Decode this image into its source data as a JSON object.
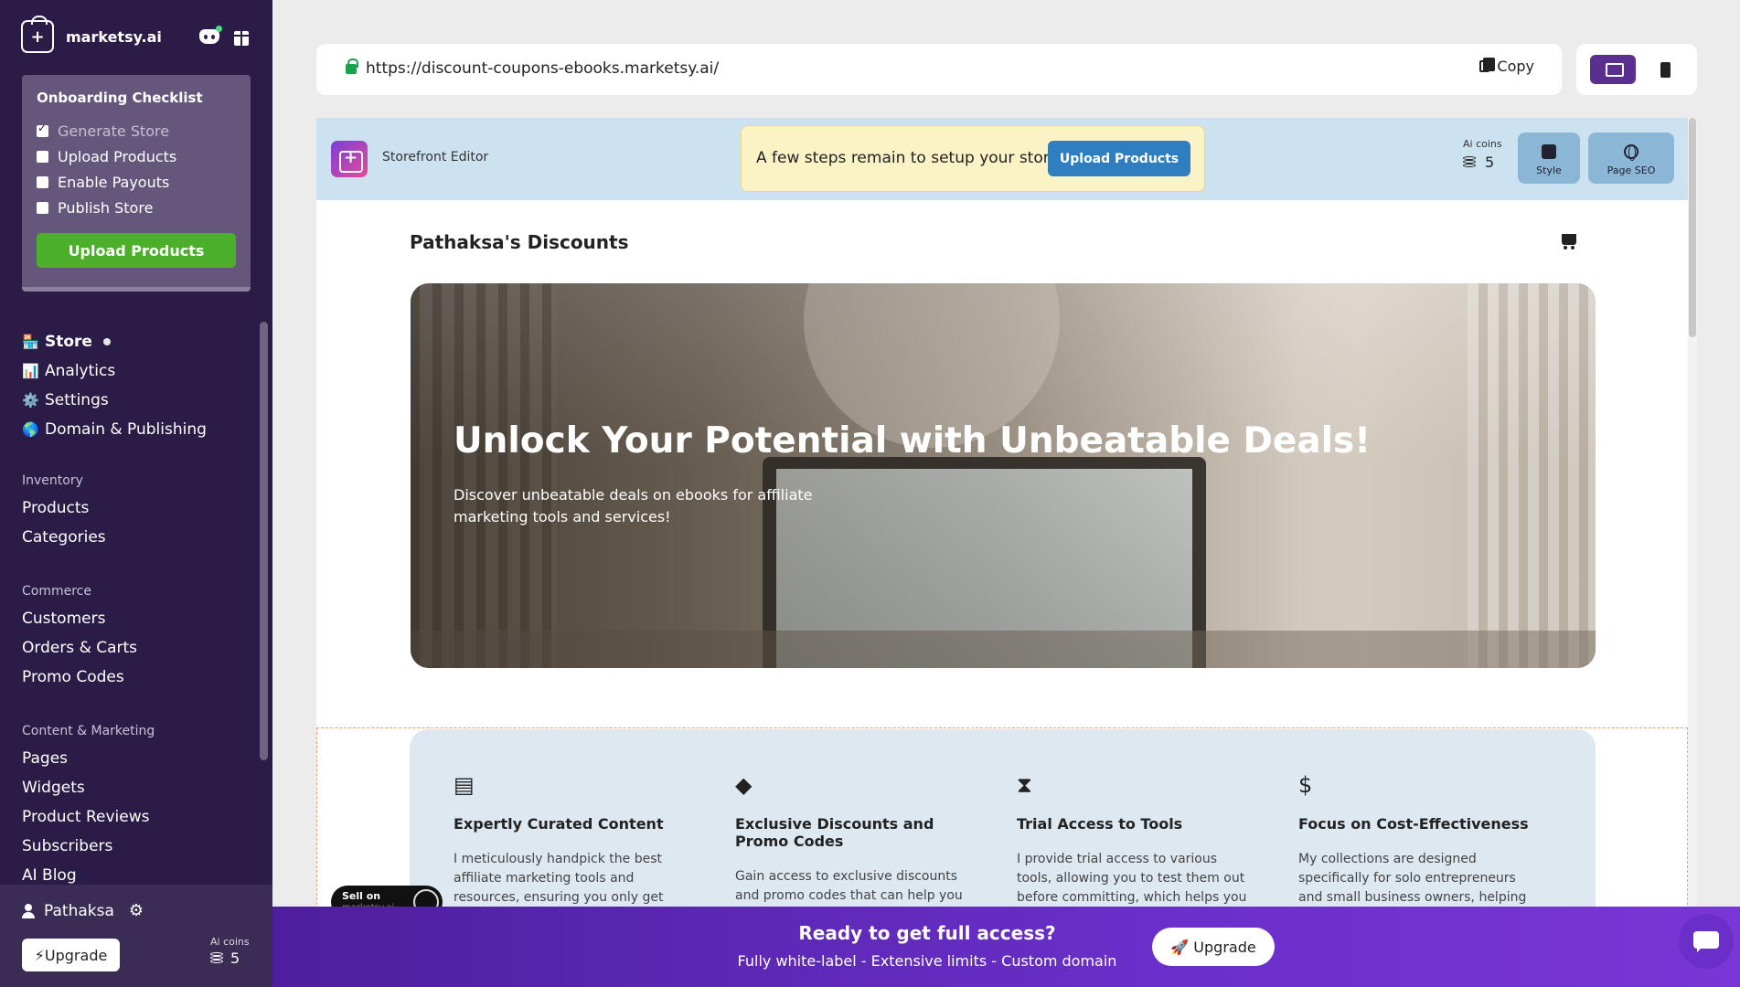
{
  "brand": {
    "name": "marketsy.ai"
  },
  "checklist": {
    "title": "Onboarding Checklist",
    "items": [
      {
        "label": "Generate Store",
        "checked": true
      },
      {
        "label": "Upload Products",
        "checked": false
      },
      {
        "label": "Enable Payouts",
        "checked": false
      },
      {
        "label": "Publish Store",
        "checked": false
      }
    ],
    "button": "Upload Products"
  },
  "nav": {
    "main": [
      {
        "emoji": "🏪",
        "label": "Store"
      },
      {
        "emoji": "📊",
        "label": "Analytics"
      },
      {
        "emoji": "⚙️",
        "label": "Settings"
      },
      {
        "emoji": "🌎",
        "label": "Domain & Publishing"
      }
    ],
    "sections": [
      {
        "title": "Inventory",
        "items": [
          "Products",
          "Categories"
        ]
      },
      {
        "title": "Commerce",
        "items": [
          "Customers",
          "Orders & Carts",
          "Promo Codes"
        ]
      },
      {
        "title": "Content & Marketing",
        "items": [
          "Pages",
          "Widgets",
          "Product Reviews",
          "Subscribers",
          "AI Blog"
        ]
      }
    ]
  },
  "user": {
    "name": "Pathaksa",
    "upgrade": "⚡Upgrade",
    "coins_label": "Ai coins",
    "coins": "5"
  },
  "url": {
    "address": "https://discount-coupons-ebooks.marketsy.ai/",
    "copy": "Copy"
  },
  "editor": {
    "title": "Storefront Editor",
    "notice": "A few steps remain to setup your store",
    "notice_button": "Upload Products",
    "coins_label": "Ai coins",
    "coins": "5",
    "style": "Style",
    "seo": "Page SEO"
  },
  "store": {
    "title": "Pathaksa's Discounts",
    "hero_title": "Unlock Your Potential with Unbeatable Deals!",
    "hero_sub": "Discover unbeatable deals on ebooks for affiliate marketing tools and services!",
    "features": [
      {
        "icon": "book-icon",
        "title": "Expertly Curated Content",
        "text": "I meticulously handpick the best affiliate marketing tools and resources, ensuring you only get top-notch recommendations that suit your"
      },
      {
        "icon": "tags-icon",
        "title": "Exclusive Discounts and Promo Codes",
        "text": "Gain access to exclusive discounts and promo codes that can help you save significantly on your purchases."
      },
      {
        "icon": "hourglass-icon",
        "title": "Trial Access to Tools",
        "text": "I provide trial access to various tools, allowing you to test them out before committing, which helps you make informed decisions."
      },
      {
        "icon": "dollar-icon",
        "title": "Focus on Cost-Effectiveness",
        "text": "My collections are designed specifically for solo entrepreneurs and small business owners, helping you find cost-effective solutions that"
      }
    ],
    "sell_badge": {
      "line1": "Sell on",
      "line2": "marketsy.ai"
    }
  },
  "banner": {
    "title": "Ready to get full access?",
    "subtitle": "Fully white-label - Extensive limits - Custom domain",
    "button": "🚀 Upgrade"
  }
}
